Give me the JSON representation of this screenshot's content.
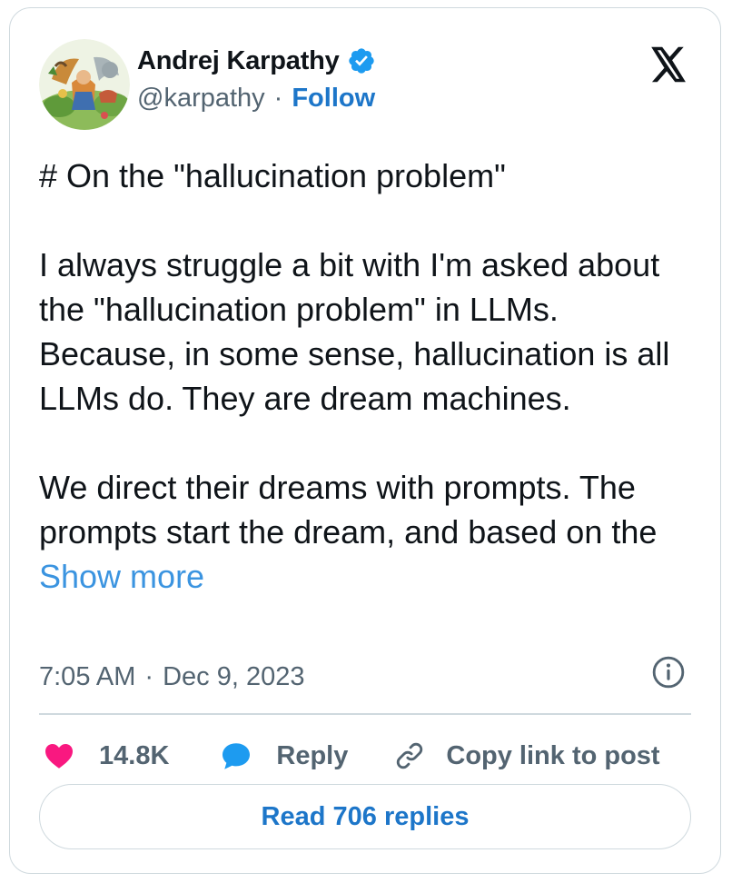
{
  "author": {
    "name": "Andrej Karpathy",
    "handle": "@karpathy",
    "separator": "·",
    "follow_label": "Follow",
    "verified_icon": "verified-badge-icon",
    "avatar_icon": "illustrated-avatar"
  },
  "platform_logo": "x-logo-icon",
  "tweet": {
    "heading": "# On the \"hallucination problem\"",
    "paragraph1": "I always struggle a bit with I'm asked about the \"hallucination problem\" in LLMs. Because, in some sense, hallucination is all LLMs do. They are dream machines.",
    "paragraph2_text": "We direct their dreams with prompts. The prompts start the dream, and based on the ",
    "show_more_label": "Show more"
  },
  "meta": {
    "time": "7:05 AM",
    "separator": "·",
    "date": "Dec 9, 2023",
    "info_icon": "info-icon"
  },
  "actions": {
    "like_count": "14.8K",
    "reply_label": "Reply",
    "copy_label": "Copy link to post"
  },
  "read_replies_label": "Read 706 replies",
  "colors": {
    "link": "#1d76c9",
    "show_more": "#3b94e0",
    "like": "#f91880",
    "reply": "#1d9bf0",
    "muted": "#536471",
    "border": "#cfd9de",
    "verified": "#1d9bf0"
  }
}
